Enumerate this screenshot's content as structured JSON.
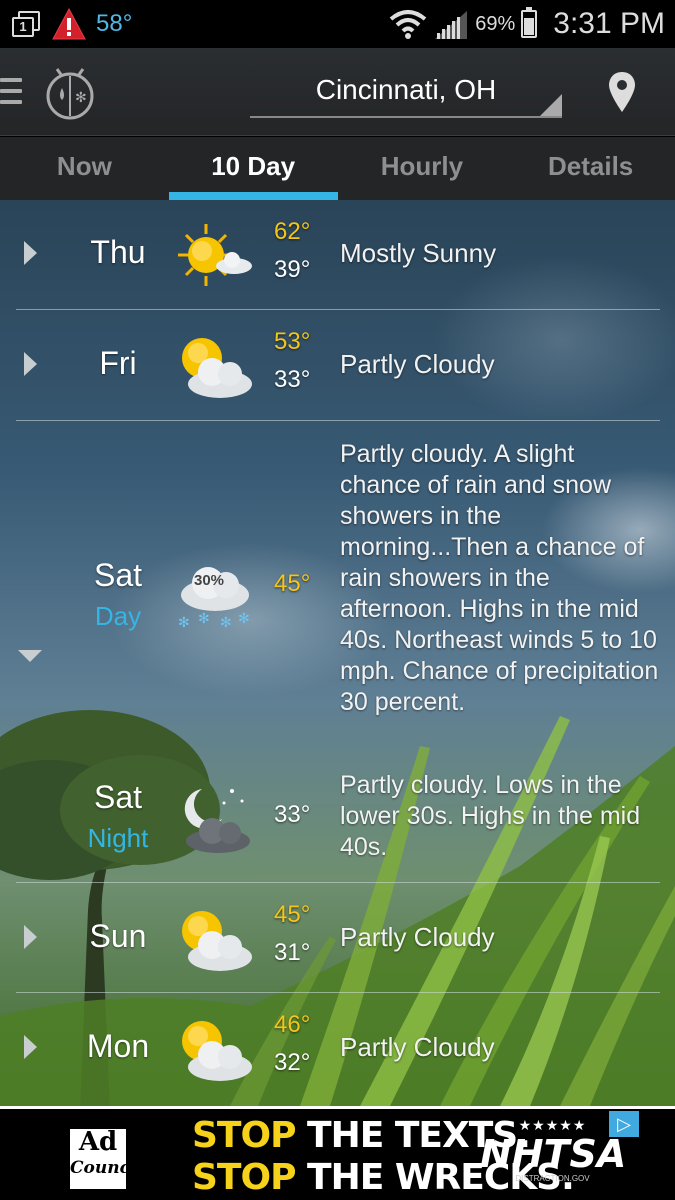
{
  "status_bar": {
    "notification_count": "1",
    "temperature": "58°",
    "battery_percent": "69%",
    "battery_level": 0.69,
    "time": "3:31 PM",
    "icons": [
      "notification-icon",
      "alert-icon",
      "wifi-icon",
      "signal-icon",
      "battery-icon"
    ]
  },
  "app_bar": {
    "location": "Cincinnati, OH",
    "icons": [
      "menu-icon",
      "weatherbug-logo-icon",
      "dropdown-caret-icon",
      "location-pin-icon"
    ]
  },
  "tabs": [
    {
      "label": "Now",
      "active": false
    },
    {
      "label": "10 Day",
      "active": true
    },
    {
      "label": "Hourly",
      "active": false
    },
    {
      "label": "Details",
      "active": false
    }
  ],
  "forecast": [
    {
      "day": "Thu",
      "high": "62°",
      "low": "39°",
      "condition": "Mostly Sunny",
      "icon": "mostly-sunny-icon"
    },
    {
      "day": "Fri",
      "high": "53°",
      "low": "33°",
      "condition": "Partly Cloudy",
      "icon": "partly-cloudy-icon"
    },
    {
      "day": "Sat",
      "period": "Day",
      "high": "45°",
      "precip_badge": "30%",
      "icon": "rain-snow-icon",
      "description": "Partly cloudy. A slight chance of rain and snow showers in the morning...Then a chance of rain showers in the afternoon. Highs in the mid 40s. Northeast winds 5 to 10 mph. Chance of precipitation 30 percent."
    },
    {
      "day": "Sat",
      "period": "Night",
      "low": "33°",
      "icon": "partly-cloudy-night-icon",
      "description": "Partly cloudy. Lows in the lower 30s. Highs in the mid 40s."
    },
    {
      "day": "Sun",
      "high": "45°",
      "low": "31°",
      "condition": "Partly Cloudy",
      "icon": "partly-cloudy-icon"
    },
    {
      "day": "Mon",
      "high": "46°",
      "low": "32°",
      "condition": "Partly Cloudy",
      "icon": "partly-cloudy-icon"
    }
  ],
  "ad": {
    "council_line1": "Ad",
    "council_line2": "Council",
    "line1_accent": "STOP",
    "line1_rest": "THE TEXTS.",
    "line2_accent": "STOP",
    "line2_rest": "THE WRECKS.",
    "sponsor_stars": "★★★★★",
    "sponsor": "NHTSA",
    "sponsor_url": "DISTRACTION.GOV",
    "adchoices_symbol": "▷"
  },
  "colors": {
    "accent": "#33b5e5",
    "high_temp": "#f5c518",
    "ad_yellow": "#f6d21a"
  }
}
